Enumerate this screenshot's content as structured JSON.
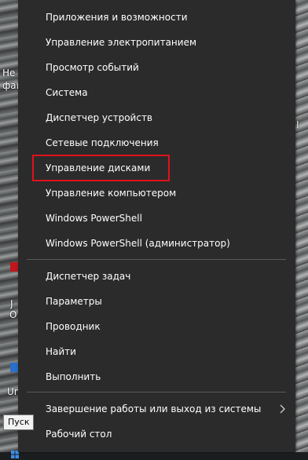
{
  "menu": {
    "items": [
      {
        "label": "Приложения и возможности"
      },
      {
        "label": "Управление электропитанием"
      },
      {
        "label": "Просмотр событий"
      },
      {
        "label": "Система"
      },
      {
        "label": "Диспетчер устройств"
      },
      {
        "label": "Сетевые подключения"
      },
      {
        "label": "Управление дисками"
      },
      {
        "label": "Управление компьютером"
      },
      {
        "label": "Windows PowerShell"
      },
      {
        "label": "Windows PowerShell (администратор)"
      },
      {
        "label": "Диспетчер задач"
      },
      {
        "label": "Параметры"
      },
      {
        "label": "Проводник"
      },
      {
        "label": "Найти"
      },
      {
        "label": "Выполнить"
      },
      {
        "label": "Завершение работы или выход из системы"
      },
      {
        "label": "Рабочий стол"
      }
    ],
    "highlighted_item": "Управление дисками",
    "highlight_color": "#e0121b",
    "background_color": "#2b2b2b"
  },
  "tooltip": {
    "text": "Пуск"
  },
  "desktop": {
    "fragments": [
      "Не",
      "фай",
      "J",
      "O",
      "Un",
      "I"
    ]
  },
  "icons": {
    "submenu_arrow": "chevron-right-icon",
    "start": "windows-start-icon"
  }
}
